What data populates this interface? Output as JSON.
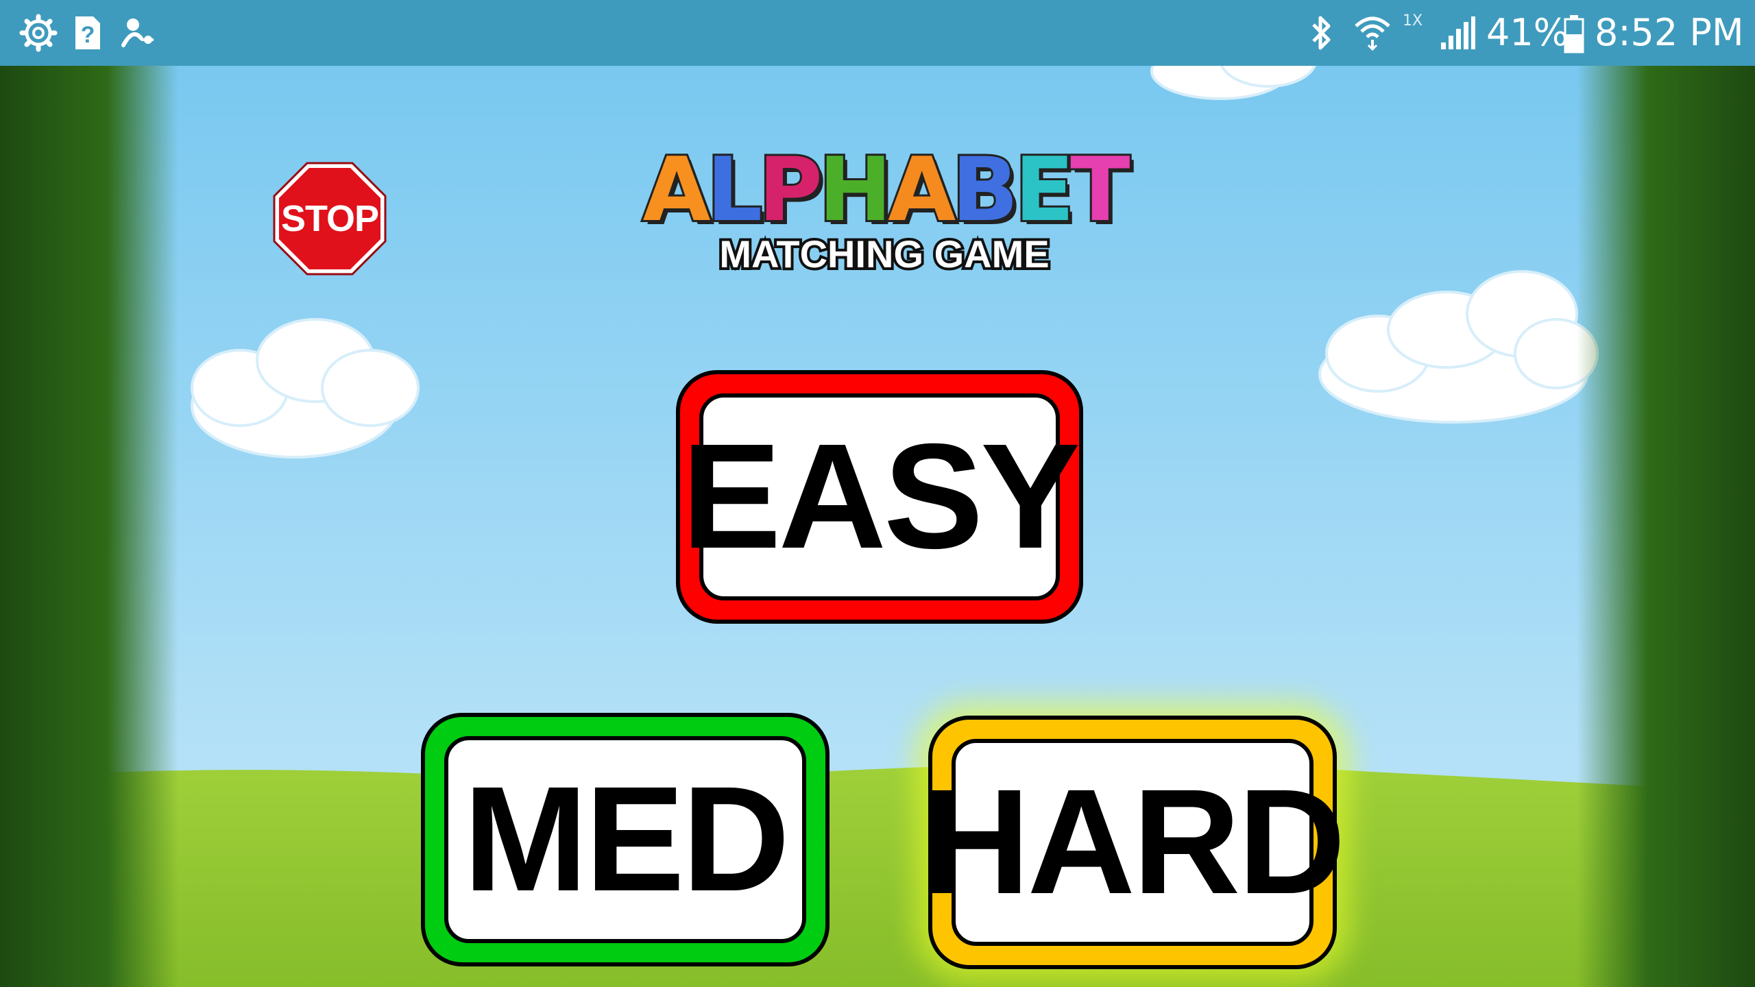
{
  "status_bar": {
    "left_icons": [
      "settings-gear-icon",
      "sim-unknown-icon",
      "person-share-icon"
    ],
    "right_icons": [
      "bluetooth-icon",
      "wifi-icon",
      "cell-signal-icon",
      "battery-icon"
    ],
    "signal_rate": "1X",
    "battery_percent": "41%",
    "time": "8:52 PM",
    "background_color": "#3f9bbd"
  },
  "game": {
    "stop_button": {
      "label": "STOP",
      "color": "#e0111b"
    },
    "logo": {
      "title_letters": [
        {
          "char": "A",
          "color": "#f7901e"
        },
        {
          "char": "L",
          "color": "#3d6fe0"
        },
        {
          "char": "P",
          "color": "#d6226a"
        },
        {
          "char": "H",
          "color": "#4caf2a"
        },
        {
          "char": "A",
          "color": "#f58a1f"
        },
        {
          "char": "B",
          "color": "#3f6fe0"
        },
        {
          "char": "E",
          "color": "#2cc3c7"
        },
        {
          "char": "T",
          "color": "#e63fb0"
        }
      ],
      "subtitle": "MATCHING GAME"
    },
    "difficulty_buttons": [
      {
        "id": "easy",
        "label": "EASY",
        "frame_color": "#ff0000"
      },
      {
        "id": "med",
        "label": "MED",
        "frame_color": "#00cc11"
      },
      {
        "id": "hard",
        "label": "HARD",
        "frame_color": "#ffc400",
        "highlighted": true
      }
    ]
  }
}
